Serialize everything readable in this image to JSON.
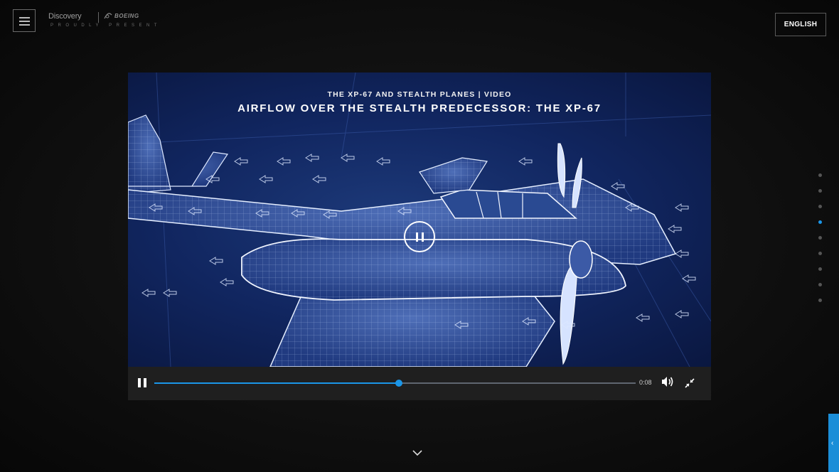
{
  "header": {
    "menu_icon": "hamburger-icon",
    "brand_discovery": "Discovery",
    "brand_boeing": "BOEING",
    "brand_tagline": "PROUDLY PRESENT",
    "language_label": "ENGLISH"
  },
  "video": {
    "subtitle": "THE XP-67 AND STEALTH PLANES | VIDEO",
    "title": "AIRFLOW OVER THE STEALTH PREDECESSOR: THE XP-67",
    "center_icon": "pause-icon",
    "progress": 0.508,
    "time": "0:08",
    "volume_icon": "volume-icon",
    "fullscreen_icon": "collapse-icon"
  },
  "section_nav": {
    "count": 9,
    "active_index": 3
  },
  "scroll_down_icon": "chevron-down-icon",
  "side_tab_icon": "chevron-left-icon",
  "colors": {
    "accent": "#1b96e8",
    "background": "#111111",
    "video_blue": "#142c6a",
    "control_bar": "#1f1f1f"
  }
}
